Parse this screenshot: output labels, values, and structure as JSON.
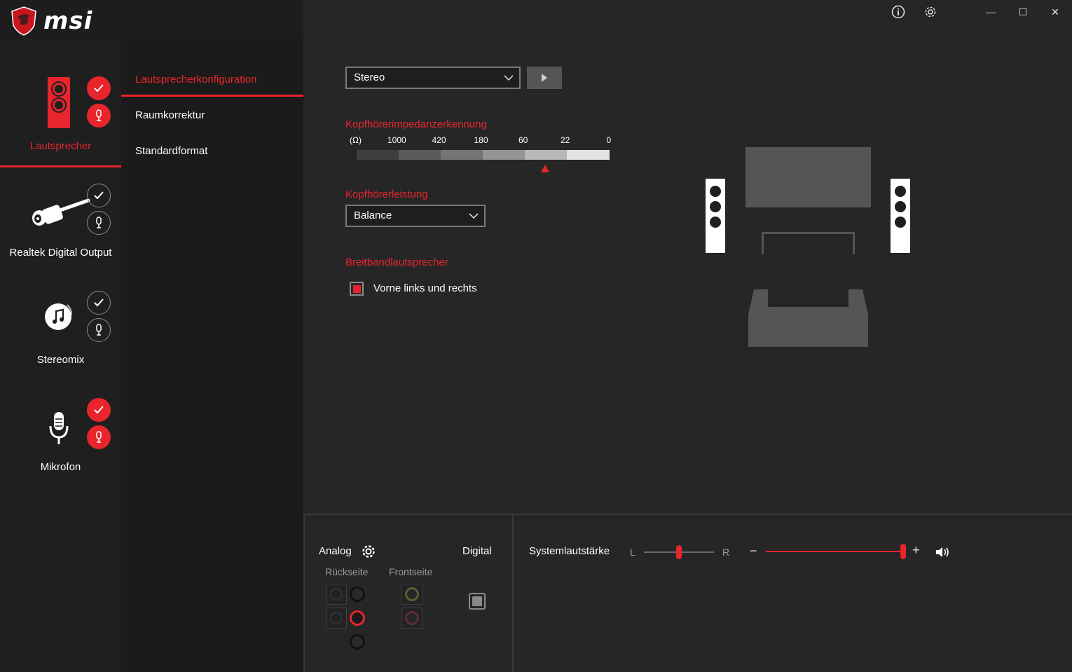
{
  "app": {
    "brand": "msi"
  },
  "window_controls": {
    "minimize": "—",
    "maximize": "☐",
    "close": "✕"
  },
  "devices": [
    {
      "label": "Lautsprecher",
      "active": true,
      "default": true,
      "comm_default": true
    },
    {
      "label": "Realtek Digital Output",
      "active": false,
      "default": false,
      "comm_default": false
    },
    {
      "label": "Stereomix",
      "active": false,
      "default": false,
      "comm_default": false
    },
    {
      "label": "Mikrofon",
      "active": false,
      "default": true,
      "comm_default": true
    }
  ],
  "submenu": {
    "items": [
      {
        "label": "Lautsprecherkonfiguration",
        "active": true
      },
      {
        "label": "Raumkorrektur",
        "active": false
      },
      {
        "label": "Standardformat",
        "active": false
      }
    ]
  },
  "config": {
    "speaker_mode": "Stereo",
    "impedance": {
      "title": "Kopfhörerimpedanzerkennung",
      "unit": "(Ω)",
      "ticks": [
        "1000",
        "420",
        "180",
        "60",
        "22",
        "0"
      ],
      "marker_fraction": 0.745
    },
    "headphone_power": {
      "title": "Kopfhörerleistung",
      "value": "Balance"
    },
    "fullrange": {
      "title": "Breitbandlautsprecher",
      "option": "Vorne links und rechts",
      "checked": true
    }
  },
  "bottom": {
    "analog": "Analog",
    "digital": "Digital",
    "rear": "Rückseite",
    "front": "Frontseite",
    "system_volume": "Systemlautstärke",
    "balance_left": "L",
    "balance_right": "R",
    "balance_value": 0.5,
    "volume_value": 1.0,
    "minus": "−",
    "plus": "+"
  },
  "colors": {
    "accent": "#e8242c",
    "background": "#262626",
    "sidebar": "#1f1f1f"
  }
}
